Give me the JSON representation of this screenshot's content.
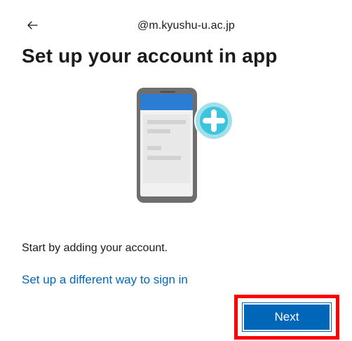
{
  "header": {
    "back_icon": "arrow-left-icon",
    "account_email": "@m.kyushu-u.ac.jp"
  },
  "main": {
    "title": "Set up your account in app",
    "illustration_icon": "phone-add-account-icon",
    "instruction": "Start by adding your account.",
    "alt_link": "Set up a different way to sign in"
  },
  "footer": {
    "next_label": "Next"
  },
  "colors": {
    "accent": "#0067b8",
    "highlight": "#ff0000",
    "phone_frame": "#6e6e6e",
    "phone_header": "#2b7cd3",
    "plus_circle": "#3bc4dc"
  }
}
